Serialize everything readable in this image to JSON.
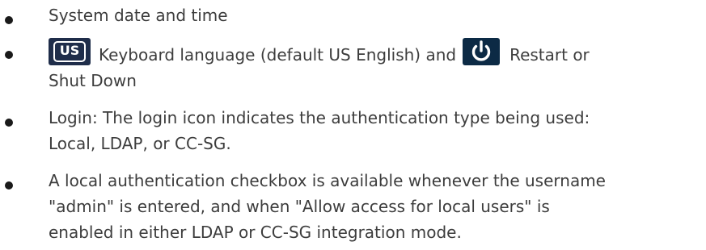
{
  "bullets": [
    {
      "lines": [
        "System date and time"
      ]
    },
    {
      "keyboard_icon_label": "US",
      "line1_middle": "Keyboard language (default US English) and",
      "line1_end": "Restart or",
      "line2": "Shut Down",
      "icons": [
        "keyboard-language-icon",
        "power-icon"
      ]
    },
    {
      "lines": [
        "Login: The login icon indicates the authentication type being used:",
        "Local, LDAP, or CC-SG."
      ]
    },
    {
      "lines": [
        "A local authentication checkbox is available whenever the username",
        "\"admin\" is entered, and when \"Allow access for local users\" is",
        "enabled in either LDAP or CC-SG integration mode."
      ]
    }
  ],
  "colors": {
    "text": "#3d3d3d",
    "bullet": "#1a1a1a",
    "keyboard_icon_bg": "#1f2d4a",
    "power_icon_bg": "#0c2a45"
  }
}
